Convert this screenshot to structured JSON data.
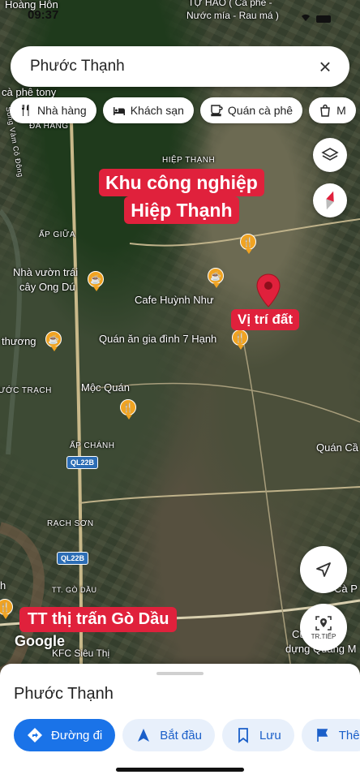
{
  "status_bar": {
    "time": "09:37",
    "location_arrow": "location-arrow-icon"
  },
  "search": {
    "query": "Phước Thạnh",
    "clear_icon": "close-icon"
  },
  "chips": [
    {
      "label": "Nhà hàng",
      "icon": "restaurant-icon"
    },
    {
      "label": "Khách sạn",
      "icon": "hotel-icon"
    },
    {
      "label": "Quán cà phê",
      "icon": "coffee-icon"
    },
    {
      "label": "M",
      "icon": "shopping-bag-icon"
    }
  ],
  "map": {
    "place_labels": {
      "top_left": "Hoàng Hôn",
      "top_center_1": "TỰ HÀO ( Cà phê -",
      "top_center_2": "Nước mía - Rau má )",
      "ca_phe_tony": "cà phê tony",
      "da_hang": "ĐA HÀNG",
      "song_vam_co": "Sông Vàm Cỏ Đông",
      "hiep_thanh": "HIỆP THẠNH",
      "ap_giua": "ẤP GIỮA",
      "nha_vuon_1": "Nhà vườn trái",
      "nha_vuon_2": "cây Ong Dú",
      "cafe_huynh_nhu": "Cafe Huỳnh Như",
      "thuong": "thương",
      "quan_an": "Quán ăn gia đình 7 Hạnh",
      "phuoc_trach": "ƯỚC TRẠCH",
      "moc_quan": "Mộc Quán",
      "ap_chanh": "ẤP CHÁNH",
      "quan_ca": "Quán Cầ",
      "rach_son": "RẠCH SƠN",
      "go_dau": "TT. GÒ DẦU",
      "ca_p": "Cà P",
      "h": "h",
      "cua_hang_1": "Cửa h",
      "cua_hang_2": "dựng Quang M",
      "kfc": "KFC Siêu Thị",
      "google": "Google"
    },
    "road_badges": [
      "QL22B",
      "QL22B"
    ],
    "callouts": {
      "kcn_line1": "Khu công nghiệp",
      "kcn_line2": "Hiệp Thạnh",
      "vi_tri": "Vị trí đất",
      "thi_tran": "TT thị trấn Gò Dầu"
    },
    "pin_color": "#e0213c",
    "poi_color": "#f0a322"
  },
  "controls": {
    "layers_icon": "layers-icon",
    "compass_icon": "compass-icon",
    "locate_icon": "navigation-arrow-icon",
    "streetview_label": "TR.TIẾP"
  },
  "sheet": {
    "title": "Phước Thạnh",
    "actions": [
      {
        "label": "Đường đi",
        "icon": "directions-icon"
      },
      {
        "label": "Bắt đầu",
        "icon": "navigate-icon"
      },
      {
        "label": "Lưu",
        "icon": "bookmark-icon"
      },
      {
        "label": "Thê",
        "icon": "flag-icon"
      }
    ]
  },
  "colors": {
    "accent": "#1a73e8",
    "callout": "#e0213c"
  }
}
